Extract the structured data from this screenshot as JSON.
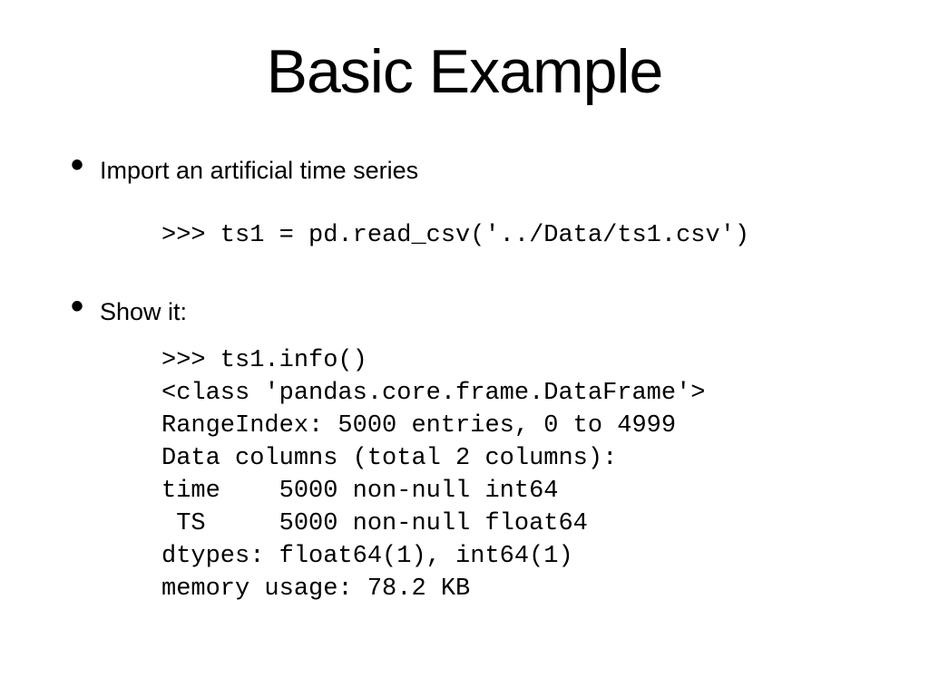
{
  "title": "Basic Example",
  "bullets": [
    {
      "text": "Import an artificial time series",
      "code": ">>> ts1 = pd.read_csv('../Data/ts1.csv')"
    },
    {
      "text": "Show it:",
      "code": ">>> ts1.info()\n<class 'pandas.core.frame.DataFrame'>\nRangeIndex: 5000 entries, 0 to 4999\nData columns (total 2 columns):\ntime    5000 non-null int64\n TS     5000 non-null float64\ndtypes: float64(1), int64(1)\nmemory usage: 78.2 KB"
    }
  ]
}
